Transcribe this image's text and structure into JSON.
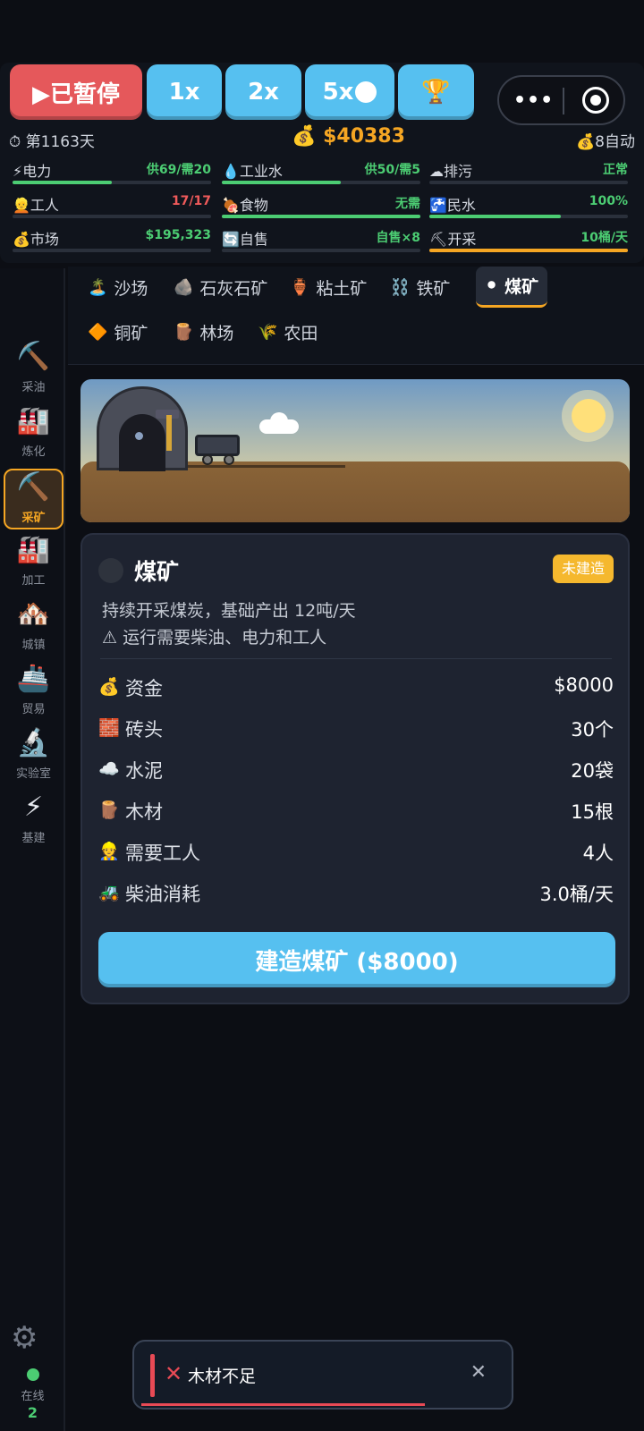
{
  "controls": {
    "pause_label": "▶已暂停",
    "speed_1x": "1x",
    "speed_2x": "2x",
    "speed_5x": "5x",
    "trophy_icon": "🏆",
    "menu_dots": "•••"
  },
  "status": {
    "day": "第1163天",
    "money": "$40383",
    "auto": "8自动"
  },
  "stats": [
    {
      "icon": "⚡",
      "label": "电力",
      "value": "供69/需20",
      "color": "green",
      "level": 0.5
    },
    {
      "icon": "💧",
      "label": "工业水",
      "value": "供50/需5",
      "color": "green",
      "level": 0.6
    },
    {
      "icon": "☁",
      "label": "排污",
      "value": "正常",
      "color": "green",
      "level": 0.0
    },
    {
      "icon": "👱",
      "label": "工人",
      "value": "17/17",
      "color": "red",
      "level": 0.0
    },
    {
      "icon": "🍖",
      "label": "食物",
      "value": "无需",
      "color": "green",
      "level": 1.0
    },
    {
      "icon": "🚰",
      "label": "民水",
      "value": "100%",
      "color": "green",
      "level": 0.66
    },
    {
      "icon": "💰",
      "label": "市场",
      "value": "$195,323",
      "color": "green",
      "level": 0.0
    },
    {
      "icon": "🔄",
      "label": "自售",
      "value": "自售×8",
      "color": "green",
      "level": 0.0
    },
    {
      "icon": "⛏",
      "label": "开采",
      "value": "10桶/天",
      "color": "green",
      "level": 1.0
    }
  ],
  "sidebar": [
    {
      "icon": "⛏️",
      "label": "采油",
      "active": false
    },
    {
      "icon": "🏭",
      "label": "炼化",
      "active": false
    },
    {
      "icon": "⛏️",
      "label": "采矿",
      "active": true
    },
    {
      "icon": "🏭",
      "label": "加工",
      "active": false
    },
    {
      "icon": "🏘️",
      "label": "城镇",
      "active": false
    },
    {
      "icon": "🚢",
      "label": "贸易",
      "active": false
    },
    {
      "icon": "🔬",
      "label": "实验室",
      "active": false
    },
    {
      "icon": "⚡",
      "label": "基建",
      "active": false
    }
  ],
  "online": {
    "label": "在线",
    "count": "2"
  },
  "tabs": [
    {
      "icon": "🏝️",
      "label": "沙场"
    },
    {
      "icon": "🪨",
      "label": "石灰石矿"
    },
    {
      "icon": "🏺",
      "label": "粘土矿"
    },
    {
      "icon": "⛓️",
      "label": "铁矿"
    },
    {
      "icon": "⚫",
      "label": "煤矿",
      "active": true
    },
    {
      "icon": "🔶",
      "label": "铜矿"
    },
    {
      "icon": "🪵",
      "label": "林场"
    },
    {
      "icon": "🌾",
      "label": "农田"
    }
  ],
  "card": {
    "title": "煤矿",
    "badge": "未建造",
    "description": "持续开采煤炭，基础产出 12吨/天",
    "warning": "⚠ 运行需要柴油、电力和工人",
    "rows": [
      {
        "icon": "💰",
        "label": "资金",
        "value": "$8000"
      },
      {
        "icon": "🧱",
        "label": "砖头",
        "value": "30个"
      },
      {
        "icon": "☁️",
        "label": "水泥",
        "value": "20袋"
      },
      {
        "icon": "🪵",
        "label": "木材",
        "value": "15根"
      },
      {
        "icon": "👷",
        "label": "需要工人",
        "value": "4人"
      },
      {
        "icon": "🚜",
        "label": "柴油消耗",
        "value": "3.0桶/天"
      }
    ],
    "build_button": "建造煤矿 ($8000)"
  },
  "toast": {
    "icon": "✕",
    "message": "木材不足",
    "close": "✕",
    "timer_remaining": 0.75
  },
  "colors": {
    "accent": "#f5a623",
    "blue": "#56c0f0",
    "red": "#e5585b",
    "green": "#4ccd73"
  }
}
